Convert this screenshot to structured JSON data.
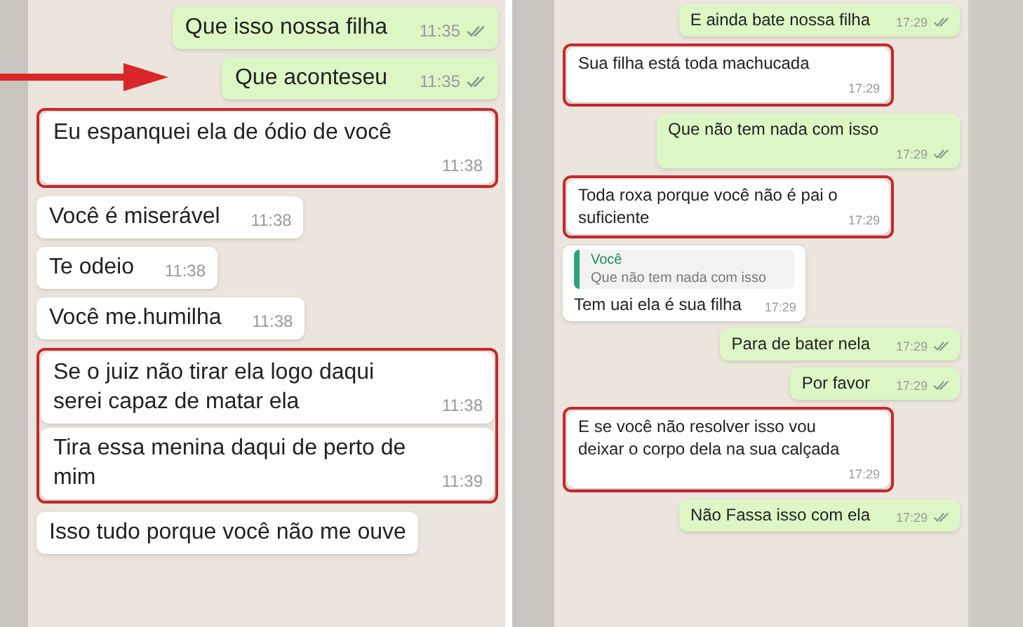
{
  "panels": [
    {
      "kind": "large",
      "items": [
        {
          "kind": "message",
          "sent": true,
          "text": "Que isso nossa filha",
          "time": "11:35"
        },
        {
          "kind": "message",
          "sent": true,
          "arrow": true,
          "text": "Que aconteseu",
          "time": "11:35"
        },
        {
          "kind": "highlight",
          "messages": [
            {
              "sent": false,
              "text": "Eu espanquei ela de ódio de você",
              "time": "11:38"
            }
          ]
        },
        {
          "kind": "message",
          "sent": false,
          "text": "Você é miserável",
          "time": "11:38"
        },
        {
          "kind": "message",
          "sent": false,
          "text": "Te odeio",
          "time": "11:38"
        },
        {
          "kind": "message",
          "sent": false,
          "text": "Você me.humilha",
          "time": "11:38"
        },
        {
          "kind": "highlight",
          "messages": [
            {
              "sent": false,
              "text": "Se o juiz não tirar ela logo daqui serei capaz de matar ela",
              "time": "11:38"
            },
            {
              "sent": false,
              "text": "Tira essa menina daqui de perto de mim",
              "time": "11:39"
            }
          ]
        },
        {
          "kind": "message",
          "sent": false,
          "text": "Isso tudo porque você não me ouve"
        }
      ]
    },
    {
      "kind": "small",
      "items": [
        {
          "kind": "message",
          "sent": true,
          "text": "E ainda bate nossa filha",
          "time": "17:29"
        },
        {
          "kind": "highlight",
          "messages": [
            {
              "sent": false,
              "text": "Sua filha está toda machucada",
              "time": "17:29"
            }
          ]
        },
        {
          "kind": "message",
          "sent": true,
          "text": "Que não tem nada com isso",
          "time": "17:29"
        },
        {
          "kind": "highlight",
          "messages": [
            {
              "sent": false,
              "text": "Toda roxa porque você não é pai o suficiente",
              "time": "17:29"
            }
          ]
        },
        {
          "kind": "message",
          "sent": false,
          "quote_author": "Você",
          "quote_text": "Que não tem nada com isso",
          "text": "Tem uai ela é sua filha",
          "time": "17:29"
        },
        {
          "kind": "message",
          "sent": true,
          "text": "Para de bater nela",
          "time": "17:29"
        },
        {
          "kind": "message",
          "sent": true,
          "text": "Por favor",
          "time": "17:29"
        },
        {
          "kind": "highlight",
          "messages": [
            {
              "sent": false,
              "text": "E se você não resolver isso vou deixar o corpo dela na sua calçada",
              "time": "17:29"
            }
          ]
        },
        {
          "kind": "message",
          "sent": true,
          "text": "Não Fassa isso com ela",
          "time": "17:29"
        }
      ]
    }
  ]
}
